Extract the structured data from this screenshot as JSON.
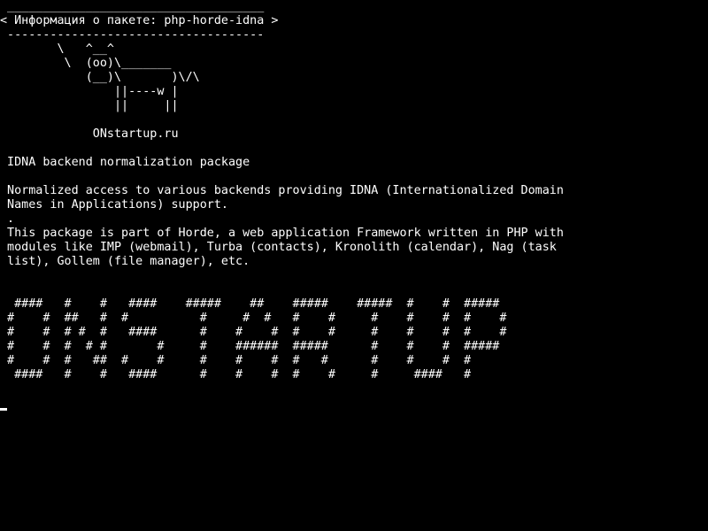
{
  "terminal": {
    "lines": [
      " ____________________________________",
      "< Информация о пакете: php-horde-idna >",
      " ------------------------------------",
      "        \\   ^__^",
      "         \\  (oo)\\_______",
      "            (__)\\       )\\/\\",
      "                ||----w |",
      "                ||     ||",
      "",
      "             ONstartup.ru",
      "",
      " IDNA backend normalization package",
      "",
      " Normalized access to various backends providing IDNA (Internationalized Domain",
      " Names in Applications) support.",
      " .",
      " This package is part of Horde, a web application Framework written in PHP with",
      " modules like IMP (webmail), Turba (contacts), Kronolith (calendar), Nag (task",
      " list), Gollem (file manager), etc.",
      "",
      "",
      "  ####   #    #   ####    #####    ##    #####    #####  #    #  #####",
      " #    #  ##   #  #          #     #  #   #    #     #    #    #  #    #",
      " #    #  # #  #   ####      #    #    #  #    #     #    #    #  #    #",
      " #    #  #  # #       #     #    ######  #####      #    #    #  #####",
      " #    #  #   ##  #    #     #    #    #  #   #      #    #    #  #",
      "  ####   #    #   ####      #    #    #  #    #     #     ####   #"
    ]
  },
  "colors": {
    "background": "#000000",
    "foreground": "#ffffff"
  }
}
